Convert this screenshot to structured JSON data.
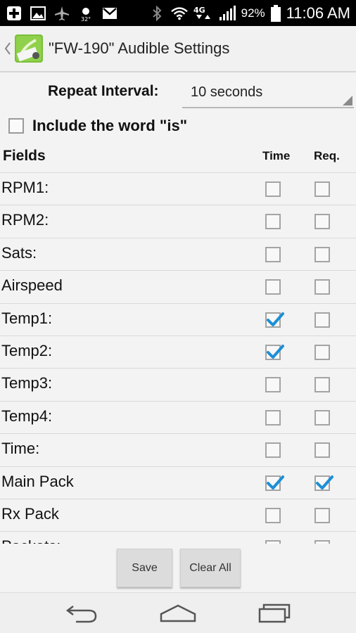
{
  "status_bar": {
    "battery_percent": "92%",
    "time": "11:06 AM",
    "network": "4G",
    "temperature_icon_text": "32°",
    "icons": [
      "plus-icon",
      "image-icon",
      "airplane-icon",
      "weather-icon",
      "gmail-icon",
      "bluetooth-icon",
      "wifi-icon",
      "signal-icon",
      "battery-icon"
    ]
  },
  "action_bar": {
    "title": "\"FW-190\" Audible Settings"
  },
  "repeat": {
    "label": "Repeat Interval:",
    "value": "10 seconds"
  },
  "include_is": {
    "label": "Include the word \"is\"",
    "checked": false
  },
  "table": {
    "headers": {
      "fields": "Fields",
      "time": "Time",
      "req": "Req."
    },
    "rows": [
      {
        "label": "RPM1:",
        "time": false,
        "req": false
      },
      {
        "label": "RPM2:",
        "time": false,
        "req": false
      },
      {
        "label": "Sats:",
        "time": false,
        "req": false
      },
      {
        "label": "Airspeed",
        "time": false,
        "req": false
      },
      {
        "label": "Temp1:",
        "time": true,
        "req": false
      },
      {
        "label": "Temp2:",
        "time": true,
        "req": false
      },
      {
        "label": "Temp3:",
        "time": false,
        "req": false
      },
      {
        "label": "Temp4:",
        "time": false,
        "req": false
      },
      {
        "label": "Time:",
        "time": false,
        "req": false
      },
      {
        "label": "Main Pack",
        "time": true,
        "req": true
      },
      {
        "label": "Rx Pack",
        "time": false,
        "req": false
      },
      {
        "label": "Packets:",
        "time": false,
        "req": false
      }
    ]
  },
  "buttons": {
    "save": "Save",
    "clear_all": "Clear All"
  },
  "colors": {
    "check": "#1d8fd6",
    "status_bar": "#000000"
  }
}
